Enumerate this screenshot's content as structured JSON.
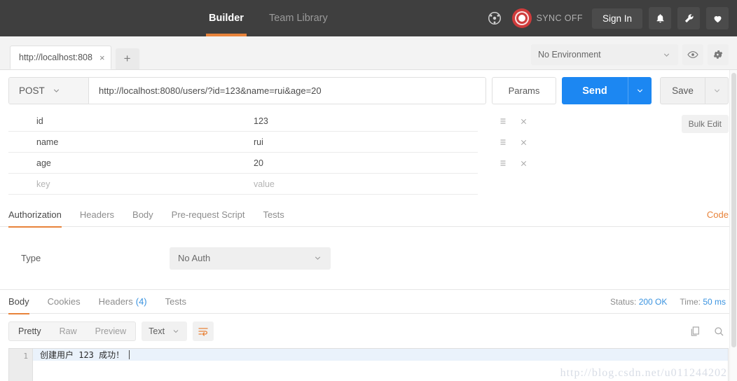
{
  "header": {
    "nav": [
      {
        "label": "Builder",
        "active": true
      },
      {
        "label": "Team Library",
        "active": false
      }
    ],
    "interceptor_icon": "interceptor-icon",
    "sync_label": "SYNC OFF",
    "signin_label": "Sign In",
    "icons": [
      "bell-icon",
      "wrench-icon",
      "heart-icon"
    ],
    "bg_color": "#3f3f3f",
    "accent_color": "#e8833a"
  },
  "tabstrip": {
    "tab_label": "http://localhost:808",
    "close_glyph": "×",
    "new_tab_glyph": "+",
    "environment": "No Environment",
    "eye_icon": "eye-icon",
    "gear_icon": "gear-icon"
  },
  "request": {
    "method": "POST",
    "url": "http://localhost:8080/users/?id=123&name=rui&age=20",
    "params_label": "Params",
    "send_label": "Send",
    "save_label": "Save",
    "send_color": "#1c87f2"
  },
  "params": {
    "bulk_edit_label": "Bulk Edit",
    "key_placeholder": "key",
    "value_placeholder": "value",
    "rows": [
      {
        "key": "id",
        "value": "123"
      },
      {
        "key": "name",
        "value": "rui"
      },
      {
        "key": "age",
        "value": "20"
      }
    ]
  },
  "request_tabs": {
    "items": [
      {
        "label": "Authorization",
        "active": true
      },
      {
        "label": "Headers",
        "active": false
      },
      {
        "label": "Body",
        "active": false
      },
      {
        "label": "Pre-request Script",
        "active": false
      },
      {
        "label": "Tests",
        "active": false
      }
    ],
    "code_link": "Code"
  },
  "authorization": {
    "type_label": "Type",
    "type_value": "No Auth"
  },
  "response": {
    "tabs": [
      {
        "label": "Body",
        "count": "",
        "active": true
      },
      {
        "label": "Cookies",
        "count": "",
        "active": false
      },
      {
        "label": "Headers",
        "count": "(4)",
        "active": false
      },
      {
        "label": "Tests",
        "count": "",
        "active": false
      }
    ],
    "status_label": "Status:",
    "status_value": "200 OK",
    "time_label": "Time:",
    "time_value": "50 ms",
    "status_color": "#3a93e0",
    "view_modes": [
      {
        "label": "Pretty",
        "active": true
      },
      {
        "label": "Raw",
        "active": false
      },
      {
        "label": "Preview",
        "active": false
      }
    ],
    "format": "Text",
    "wrap_icon": "word-wrap-icon",
    "copy_icon": "copy-icon",
    "search_icon": "search-icon",
    "body_line_number": "1",
    "body_text": "创建用户 123 成功！"
  },
  "watermark": "http://blog.csdn.net/u011244202"
}
